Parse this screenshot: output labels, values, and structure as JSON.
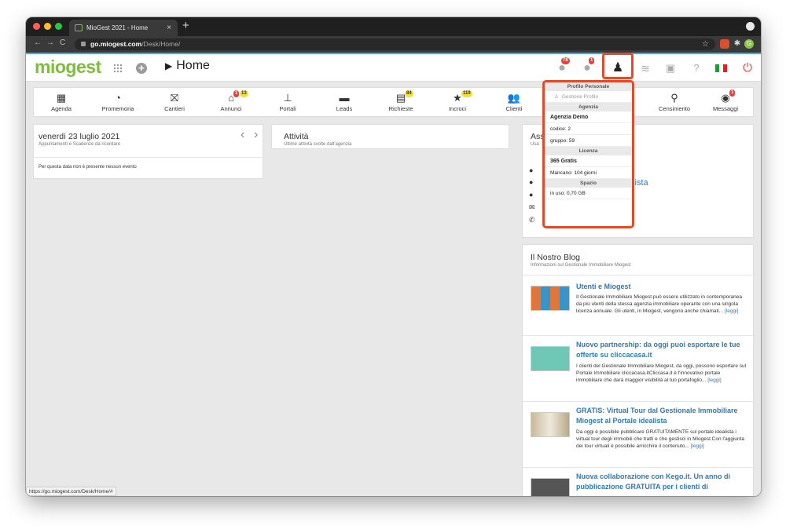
{
  "browser": {
    "tab_title": "MioGest 2021 - Home",
    "tab_close": "×",
    "new_tab": "+",
    "url_domain": "go.miogest.com",
    "url_path": "/Desk/Home/",
    "status_url": "https://go.miogest.com/Desk/Home/#",
    "back": "←",
    "forward": "→",
    "reload": "C",
    "bookmark_star": "☆",
    "ext_label": "G"
  },
  "header": {
    "logo": "miogest",
    "breadcrumb": "Home",
    "breadcrumb_arrow": "▶",
    "alerts_badge": "78",
    "messages_badge": "1"
  },
  "menu": {
    "items": [
      {
        "label": "Agenda",
        "icon": "calendar-icon",
        "glyph": "▦"
      },
      {
        "label": "Promemoria",
        "icon": "alarm-clock-icon",
        "glyph": "◔"
      },
      {
        "label": "Cantieri",
        "icon": "crane-icon",
        "glyph": "⛝"
      },
      {
        "label": "Annunci",
        "icon": "house-icon",
        "glyph": "⌂",
        "badge1": "1",
        "badge2": "13"
      },
      {
        "label": "Portali",
        "icon": "sitemap-icon",
        "glyph": "⊥"
      },
      {
        "label": "Leads",
        "icon": "chat-bubble-icon",
        "glyph": "▬"
      },
      {
        "label": "Richieste",
        "icon": "list-icon",
        "glyph": "▤",
        "badge": "84"
      },
      {
        "label": "Incroci",
        "icon": "star-icon",
        "glyph": "★",
        "badge": "119"
      },
      {
        "label": "Clienti",
        "icon": "users-icon",
        "glyph": "👥"
      },
      {
        "label": "Censimento",
        "icon": "map-marker-icon",
        "glyph": "⚲"
      },
      {
        "label": "Messaggi",
        "icon": "message-icon",
        "glyph": "◉",
        "badge": "1"
      }
    ]
  },
  "agenda": {
    "date": "venerdì 23 luglio 2021",
    "subtitle": "Appuntamenti e Scadenze da ricordare",
    "empty": "Per questa data non è presente nessun evento",
    "prev": "‹",
    "next": "›"
  },
  "activity": {
    "title": "Attività",
    "subtitle": "Ultime attività svolte dall'agenzia"
  },
  "assistance": {
    "title": "Ass",
    "subtitle": "Usa",
    "link_fragment": "alista"
  },
  "blog": {
    "title": "Il Nostro Blog",
    "subtitle": "Informazioni sul Gestionale Immobiliare Miogest",
    "leggi": "[leggi]",
    "posts": [
      {
        "title": "Utenti e Miogest",
        "text": "Il Gestionale Immobiliare Miogest può essere utilizzato in contemporanea da più utenti della stessa agenzia immobiliare operante con una singola licenza annuale. Gli utenti, in Miogest, vengono anche chiamati..."
      },
      {
        "title": "Nuovo partnership: da oggi puoi esportare le tue offerte su cliccacasa.it",
        "text": "I clienti del Gestionale Immobiliare Miogest, da oggi, possono esportare sul Portale Immobiliare cliccacasa.itCliccasa.it è l'innovativo portale immobiliare che darà maggior visibilità al tuo portafoglio..."
      },
      {
        "title": "GRATIS: Virtual Tour dal Gestionale Immobiliare Miogest al Portale idealista",
        "text": "Da oggi è possibile pubblicare GRATUITAMENTE sul portale idealista i virtual tour degli immobili che tratti e che gestisci in Miogest.Con l'aggiunta dei tour virtuali è possibile arricchire il contenuto..."
      },
      {
        "title": "Nuova collaborazione con Kego.it. Un anno di pubblicazione GRATUITA per i clienti di",
        "text": ""
      }
    ]
  },
  "profile_menu": {
    "header": "Profilo Personale",
    "gestione": "Gestione Profilo",
    "agenzia_head": "Agenzia",
    "agenzia_name": "Agenzia Demo",
    "codice": "codice: 2",
    "gruppo": "gruppo: 59",
    "licenza_head": "Licenza",
    "licenza_name": "365 Gratis",
    "mancano": "Mancano: 104 giorni",
    "spazio_head": "Spazio",
    "in_uso": "in uso: 0,70 GB"
  },
  "colors": {
    "brand_green": "#7dbd3d",
    "accent_blue": "#2d7ab6",
    "highlight_red": "#e14a2a",
    "badge_red": "#e0433a",
    "badge_yellow": "#f3e03a"
  }
}
